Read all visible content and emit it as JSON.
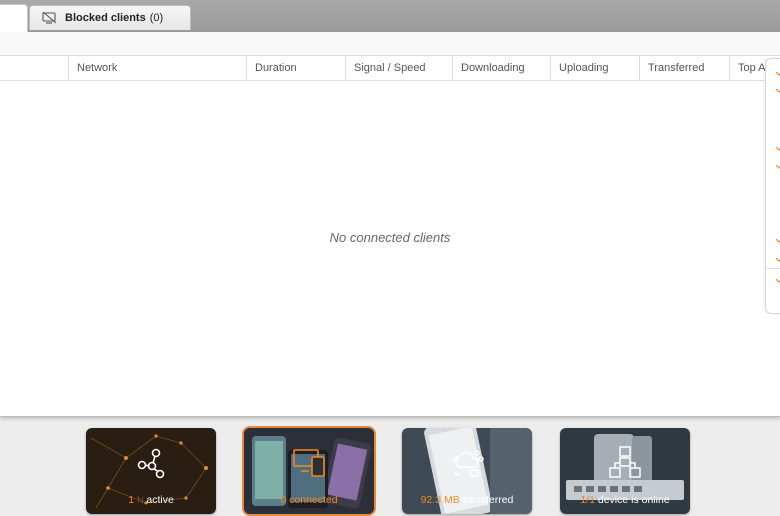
{
  "tabs": {
    "blocked": {
      "label": "Blocked clients",
      "count": "(0)"
    }
  },
  "table": {
    "columns": [
      "Network",
      "Duration",
      "Signal / Speed",
      "Downloading",
      "Uploading",
      "Transferred",
      "Top Ap"
    ],
    "empty_message": "No connected clients"
  },
  "stats": [
    {
      "icon": "network-nodes-icon",
      "number": "1",
      "faded": "N",
      "text": "active"
    },
    {
      "icon": "devices-icon",
      "number": "0",
      "faded": "",
      "text": "connected"
    },
    {
      "icon": "cloud-transfer-icon",
      "number": "92.3 MB",
      "faded": "",
      "text": "transferred"
    },
    {
      "icon": "topology-icon",
      "number": "1/1",
      "faded": "",
      "text": "device is online"
    }
  ],
  "colors": {
    "accent": "#ee8a22"
  }
}
